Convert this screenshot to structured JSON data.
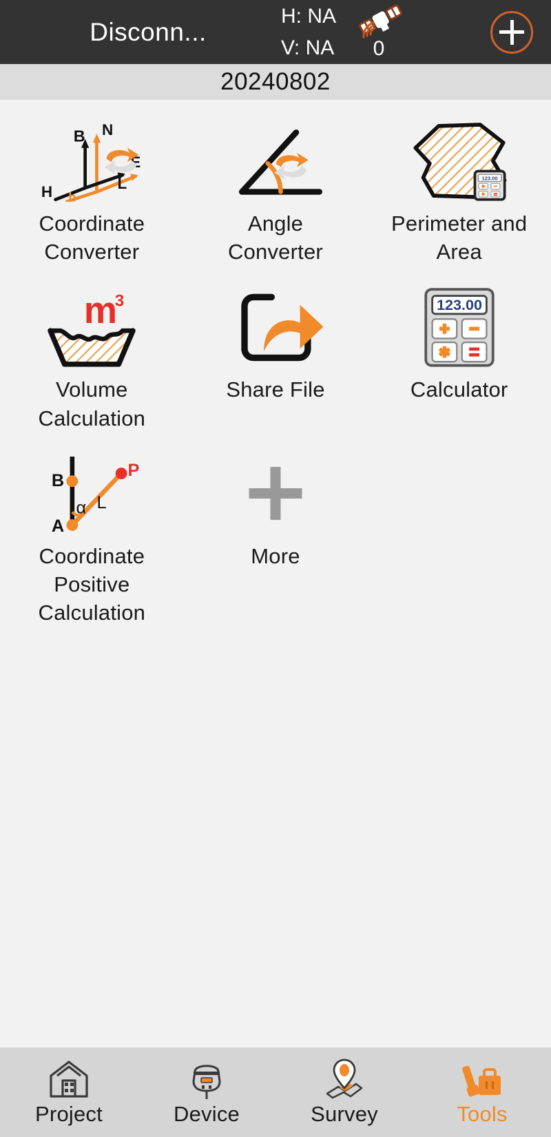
{
  "statusbar": {
    "connection_status": "Disconn...",
    "h_label": "H: NA",
    "v_label": "V: NA",
    "satellite_count": "0",
    "satellite_icon": "satellite-icon",
    "add_button_label": "+"
  },
  "project": {
    "name": "20240802"
  },
  "tools": {
    "items": [
      {
        "label": "Coordinate Converter",
        "icon": "coordinate-converter-icon",
        "axis_labels": {
          "b": "B",
          "n": "N",
          "e": "E",
          "l": "L",
          "h_upper": "H",
          "h_lower": "h"
        }
      },
      {
        "label": "Angle Converter",
        "icon": "angle-converter-icon"
      },
      {
        "label": "Perimeter and Area",
        "icon": "perimeter-area-icon",
        "calculator_display": "123.00"
      },
      {
        "label": "Volume Calculation",
        "icon": "volume-calculation-icon",
        "unit": "m",
        "exponent": "3"
      },
      {
        "label": "Share File",
        "icon": "share-file-icon"
      },
      {
        "label": "Calculator",
        "icon": "calculator-icon",
        "display": "123.00",
        "keys": [
          "+",
          "–",
          "∗",
          "="
        ]
      },
      {
        "label": "Coordinate Positive Calculation",
        "icon": "coordinate-positive-calculation-icon",
        "point_labels": {
          "b": "B",
          "a": "A",
          "p": "P",
          "angle": "α",
          "length": "L"
        }
      },
      {
        "label": "More",
        "icon": "more-plus-icon"
      }
    ]
  },
  "navbar": {
    "items": [
      {
        "label": "Project",
        "icon": "project-house-icon",
        "active": false
      },
      {
        "label": "Device",
        "icon": "device-receiver-icon",
        "active": false
      },
      {
        "label": "Survey",
        "icon": "survey-map-pin-icon",
        "active": false
      },
      {
        "label": "Tools",
        "icon": "tools-toolbox-icon",
        "active": true
      }
    ]
  },
  "colors": {
    "accent_orange": "#f08a2a",
    "dark_orange": "#d4622a",
    "statusbar_bg": "#333333",
    "project_bg": "#dcdcdc",
    "content_bg": "#f2f2f2",
    "navbar_bg": "#d5d5d5",
    "red": "#e8302a",
    "display_blue": "#2b3f7a"
  }
}
